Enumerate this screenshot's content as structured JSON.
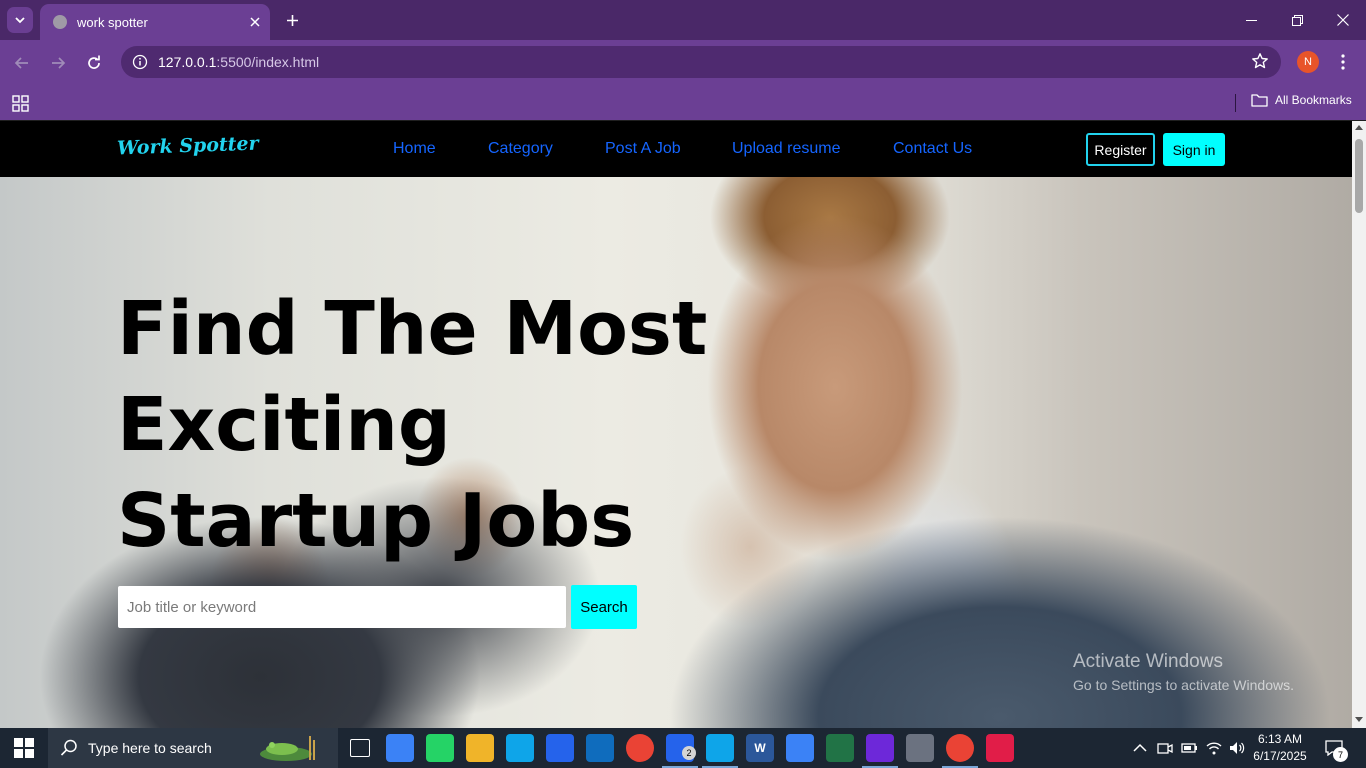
{
  "browser": {
    "tab_title": "work spotter",
    "url_host": "127.0.0.1",
    "url_path": ":5500/index.html",
    "profile_initial": "N",
    "all_bookmarks": "All Bookmarks"
  },
  "site": {
    "logo": "Work Spotter",
    "nav": [
      "Home",
      "Category",
      "Post A Job",
      "Upload resume",
      "Contact Us"
    ],
    "register_label": "Register",
    "signin_label": "Sign in",
    "headline_lines": [
      "Find The Most",
      "Exciting",
      "Startup Jobs"
    ],
    "search_placeholder": "Job title or keyword",
    "search_button": "Search",
    "watermark_title": "Activate Windows",
    "watermark_sub": "Go to Settings to activate Windows."
  },
  "taskbar": {
    "search_placeholder": "Type here to search",
    "apps": [
      {
        "name": "task-view-icon",
        "color": "#1c2633"
      },
      {
        "name": "copilot-icon",
        "color": "#3b82f6"
      },
      {
        "name": "whatsapp-icon",
        "color": "#25d366"
      },
      {
        "name": "file-explorer-icon",
        "color": "#f0b429"
      },
      {
        "name": "edge-icon",
        "color": "#0ea5e9"
      },
      {
        "name": "microsoft-store-icon",
        "color": "#2563eb"
      },
      {
        "name": "outlook-icon",
        "color": "#0f6cbd"
      },
      {
        "name": "chrome-icon",
        "color": "#ea4335"
      },
      {
        "name": "todo-icon",
        "color": "#2563eb",
        "badge": "2"
      },
      {
        "name": "edge-dev-icon",
        "color": "#0ea5e9"
      },
      {
        "name": "word-icon",
        "color": "#2b579a",
        "text": "W"
      },
      {
        "name": "photos-icon",
        "color": "#3b82f6"
      },
      {
        "name": "excel-icon",
        "color": "#217346"
      },
      {
        "name": "visual-studio-icon",
        "color": "#6d28d9"
      },
      {
        "name": "media-player-icon",
        "color": "#6b7280"
      },
      {
        "name": "chrome-profile-icon",
        "color": "#ea4335"
      },
      {
        "name": "screen-recorder-icon",
        "color": "#e11d48"
      }
    ],
    "time": "6:13 AM",
    "date": "6/17/2025",
    "notification_count": "7"
  }
}
